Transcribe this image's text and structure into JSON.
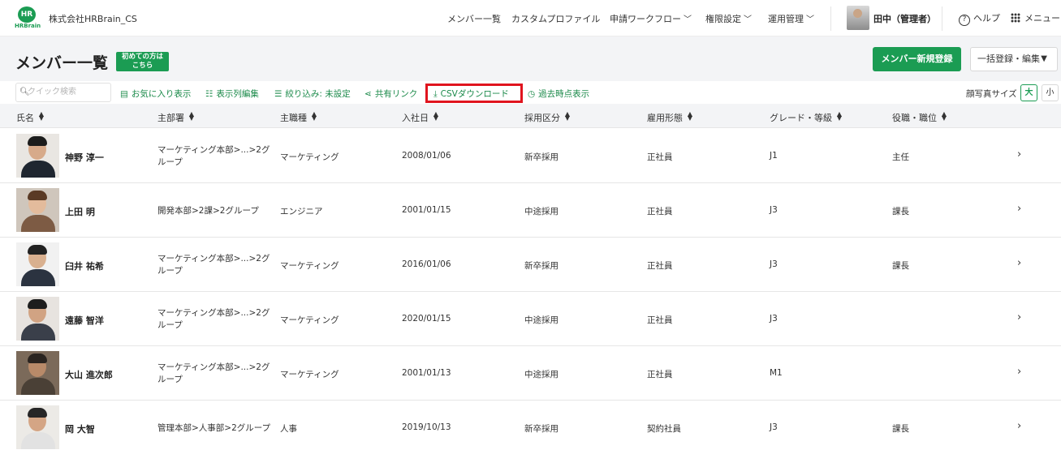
{
  "header": {
    "logo_text": "HR",
    "logo_sub": "HRBrain",
    "company": "株式会社HRBrain_CS",
    "nav": [
      {
        "label": "メンバー一覧"
      },
      {
        "label": "カスタムプロファイル"
      },
      {
        "label": "申請ワークフロー"
      },
      {
        "label": "権限設定"
      },
      {
        "label": "運用管理"
      }
    ],
    "user_name": "田中（管理者）",
    "help_label": "ヘルプ",
    "menu_label": "メニュー"
  },
  "title_area": {
    "title": "メンバー一覧",
    "beginner_line1": "初めての方は",
    "beginner_line2": "こちら",
    "new_member_button": "メンバー新規登録",
    "bulk_button": "一括登録・編集"
  },
  "toolbar": {
    "search_placeholder": "クイック検索",
    "favorites": "お気に入り表示",
    "column_edit": "表示列編集",
    "filter": "絞り込み: 未設定",
    "share_link": "共有リンク",
    "csv_download": "CSVダウンロード",
    "past_view": "過去時点表示",
    "photo_size_label": "顔写真サイズ",
    "size_large": "大",
    "size_small": "小"
  },
  "table": {
    "columns": [
      "氏名",
      "主部署",
      "主職種",
      "入社日",
      "採用区分",
      "雇用形態",
      "グレード・等級",
      "役職・職位"
    ],
    "rows": [
      {
        "name": "神野 淳一",
        "dept_line1": "マーケティング本部>...>2グ",
        "dept_line2": "ループ",
        "job": "マーケティング",
        "joined": "2008/01/06",
        "hire_type": "新卒採用",
        "employment": "正社員",
        "grade": "J1",
        "position": "主任"
      },
      {
        "name": "上田 明",
        "dept_line1": "開発本部>2課>2グループ",
        "dept_line2": "",
        "job": "エンジニア",
        "joined": "2001/01/15",
        "hire_type": "中途採用",
        "employment": "正社員",
        "grade": "J3",
        "position": "課長"
      },
      {
        "name": "臼井 祐希",
        "dept_line1": "マーケティング本部>...>2グ",
        "dept_line2": "ループ",
        "job": "マーケティング",
        "joined": "2016/01/06",
        "hire_type": "新卒採用",
        "employment": "正社員",
        "grade": "J3",
        "position": "課長"
      },
      {
        "name": "遠藤 智洋",
        "dept_line1": "マーケティング本部>...>2グ",
        "dept_line2": "ループ",
        "job": "マーケティング",
        "joined": "2020/01/15",
        "hire_type": "中途採用",
        "employment": "正社員",
        "grade": "J3",
        "position": ""
      },
      {
        "name": "大山 進次郎",
        "dept_line1": "マーケティング本部>...>2グ",
        "dept_line2": "ループ",
        "job": "マーケティング",
        "joined": "2001/01/13",
        "hire_type": "中途採用",
        "employment": "正社員",
        "grade": "M1",
        "position": ""
      },
      {
        "name": "岡 大智",
        "dept_line1": "管理本部>人事部>2グループ",
        "dept_line2": "",
        "job": "人事",
        "joined": "2019/10/13",
        "hire_type": "新卒採用",
        "employment": "契約社員",
        "grade": "J3",
        "position": "課長"
      }
    ]
  },
  "colors": {
    "brand_green": "#1b9c53",
    "highlight_red": "#e0141e"
  }
}
